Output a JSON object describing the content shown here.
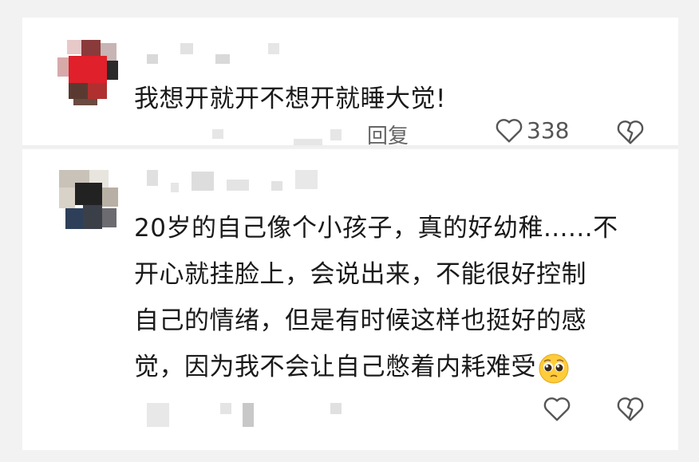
{
  "comments": [
    {
      "text": "我想开就开不想开就睡大觉!",
      "reply_label": "回复",
      "like_count": "338"
    },
    {
      "lines": [
        "20岁的自己像个小孩子，真的好幼稚......不",
        "开心就挂脸上，会说出来，不能很好控制",
        "自己的情绪，但是有时候这样也挺好的感",
        "觉，因为我不会让自己憋着内耗难受"
      ],
      "emoji": "pleading-face-emoji"
    }
  ],
  "icons": {
    "like": "heart-outline-icon",
    "dislike": "broken-heart-icon"
  },
  "colors": {
    "text": "#1a1a1a",
    "secondary": "#666666",
    "background": "#f2f2f2"
  }
}
